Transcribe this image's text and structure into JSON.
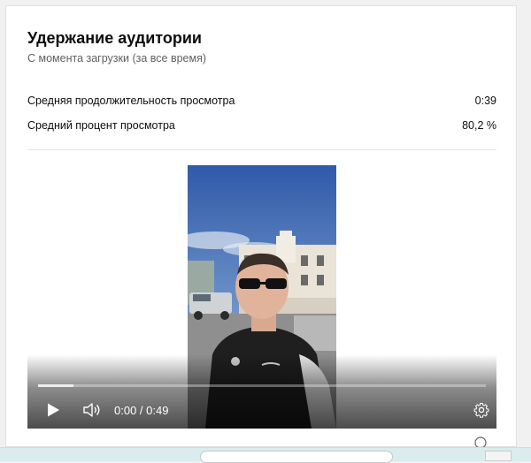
{
  "card": {
    "title": "Удержание аудитории",
    "subtitle": "С момента загрузки (за все время)"
  },
  "metrics": [
    {
      "label": "Средняя продолжительность просмотра",
      "value": "0:39"
    },
    {
      "label": "Средний процент просмотра",
      "value": "80,2 %"
    }
  ],
  "player": {
    "time": "0:00 / 0:49",
    "buffered_fraction": 0.08,
    "play_icon": "play-icon",
    "volume_icon": "volume-icon",
    "settings_icon": "gear-icon"
  },
  "colors": {
    "text_primary": "#0d0d0d",
    "text_secondary": "#606060",
    "divider": "#e5e5e5",
    "taskbar": "#d9ecee"
  }
}
